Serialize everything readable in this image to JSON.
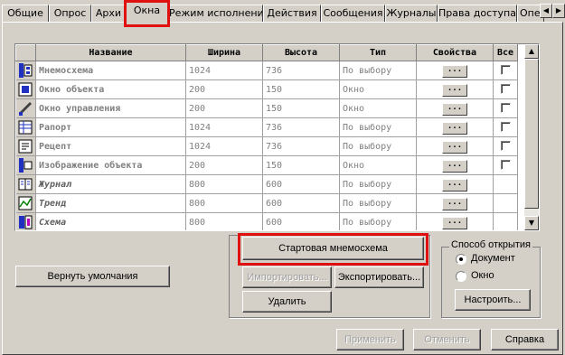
{
  "tabs": [
    {
      "label": "Общие"
    },
    {
      "label": "Опрос"
    },
    {
      "label": "Архи"
    },
    {
      "label": "Окна"
    },
    {
      "label": "Режим исполнения"
    },
    {
      "label": "Действия"
    },
    {
      "label": "Сообщения"
    },
    {
      "label": "Журналы"
    },
    {
      "label": "Права доступа"
    },
    {
      "label": "Опе"
    }
  ],
  "table": {
    "headers": {
      "name": "Название",
      "width": "Ширина",
      "height": "Высота",
      "type": "Тип",
      "props": "Свойства",
      "all": "Все"
    },
    "rows": [
      {
        "name": "Мнемосхема",
        "width": "1024",
        "height": "736",
        "type": "По выбору",
        "props": "...",
        "icon": "mnemoscheme-icon"
      },
      {
        "name": "Окно объекта",
        "width": "200",
        "height": "150",
        "type": "Окно",
        "props": "...",
        "icon": "object-window-icon"
      },
      {
        "name": "Окно управления",
        "width": "200",
        "height": "150",
        "type": "Окно",
        "props": "...",
        "icon": "control-window-icon"
      },
      {
        "name": "Рапорт",
        "width": "1024",
        "height": "736",
        "type": "По выбору",
        "props": "...",
        "icon": "report-icon"
      },
      {
        "name": "Рецепт",
        "width": "1024",
        "height": "736",
        "type": "По выбору",
        "props": "...",
        "icon": "recipe-icon"
      },
      {
        "name": "Изображение объекта",
        "width": "200",
        "height": "150",
        "type": "Окно",
        "props": "...",
        "icon": "object-image-icon"
      },
      {
        "name": "Журнал",
        "width": "800",
        "height": "600",
        "type": "По выбору",
        "props": "...",
        "icon": "journal-icon"
      },
      {
        "name": "Тренд",
        "width": "800",
        "height": "600",
        "type": "По выбору",
        "props": "...",
        "icon": "trend-icon"
      },
      {
        "name": "Схема",
        "width": "800",
        "height": "600",
        "type": "По выбору",
        "props": "...",
        "icon": "scheme-icon"
      }
    ]
  },
  "buttons": {
    "reset_defaults": "Вернуть умолчания",
    "start_mnemo": "Стартовая мнемосхема",
    "import": "Импортировать...",
    "export": "Экспортировать...",
    "delete": "Удалить",
    "configure": "Настроить...",
    "apply": "Применить",
    "cancel": "Отменить",
    "help": "Справка"
  },
  "open_mode": {
    "title": "Способ открытия",
    "options": [
      {
        "label": "Документ",
        "selected": true
      },
      {
        "label": "Окно",
        "selected": false
      }
    ]
  },
  "colors": {
    "highlight": "#e01010",
    "face": "#d4d0c8"
  }
}
